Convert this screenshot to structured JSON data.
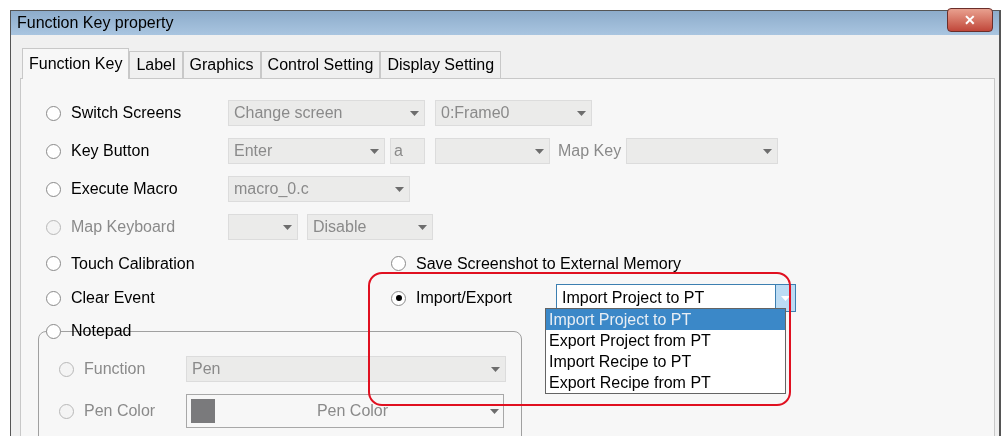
{
  "window": {
    "title": "Function Key property",
    "close": "✕"
  },
  "tabs": [
    {
      "label": "Function Key",
      "selected": true
    },
    {
      "label": "Label",
      "selected": false
    },
    {
      "label": "Graphics",
      "selected": false
    },
    {
      "label": "Control Setting",
      "selected": false
    },
    {
      "label": "Display Setting",
      "selected": false
    }
  ],
  "options": [
    {
      "label": "Switch Screens",
      "selected": false,
      "disabled": false,
      "controls": [
        {
          "kind": "dropdown",
          "value": "Change screen",
          "disabled": true
        },
        {
          "kind": "dropdown",
          "value": "0:Frame0",
          "disabled": true
        }
      ]
    },
    {
      "label": "Key Button",
      "selected": false,
      "disabled": false,
      "controls": [
        {
          "kind": "dropdown",
          "value": "Enter",
          "disabled": true
        },
        {
          "kind": "field",
          "value": "a",
          "disabled": true
        },
        {
          "kind": "dropdown",
          "disabled": true
        },
        {
          "kind": "label",
          "value": "Map Key",
          "disabled": true
        },
        {
          "kind": "dropdown",
          "disabled": true
        }
      ]
    },
    {
      "label": "Execute Macro",
      "selected": false,
      "disabled": false,
      "controls": [
        {
          "kind": "dropdown",
          "value": "macro_0.c",
          "disabled": true
        }
      ]
    },
    {
      "label": "Map Keyboard",
      "selected": false,
      "disabled": true,
      "controls": [
        {
          "kind": "dropdown",
          "disabled": true
        },
        {
          "kind": "dropdown",
          "value": "Disable",
          "disabled": true
        }
      ]
    },
    {
      "label": "Touch Calibration",
      "selected": false,
      "disabled": false,
      "right": {
        "label": "Save Screenshot to External Memory",
        "selected": false,
        "disabled": false
      }
    },
    {
      "label": "Clear Event",
      "selected": false,
      "disabled": false,
      "right": {
        "label": "Import/Export",
        "selected": true,
        "disabled": false,
        "dropdown": {
          "value": "Import Project to PT",
          "open": true,
          "items": [
            {
              "label": "Import Project to PT",
              "selected": true
            },
            {
              "label": "Export Project from PT",
              "selected": false
            },
            {
              "label": "Import Recipe to PT",
              "selected": false
            },
            {
              "label": "Export Recipe from PT",
              "selected": false
            }
          ]
        }
      }
    }
  ],
  "notepad": {
    "label": "Notepad",
    "selected": false,
    "disabled": false,
    "options": [
      {
        "label": "Function",
        "selected": false,
        "disabled": true,
        "kind": "dropdown",
        "value": "Pen"
      },
      {
        "label": "Pen Color",
        "selected": false,
        "disabled": true,
        "kind": "color",
        "value": "Pen Color",
        "color": "#7a7a7c"
      }
    ]
  }
}
